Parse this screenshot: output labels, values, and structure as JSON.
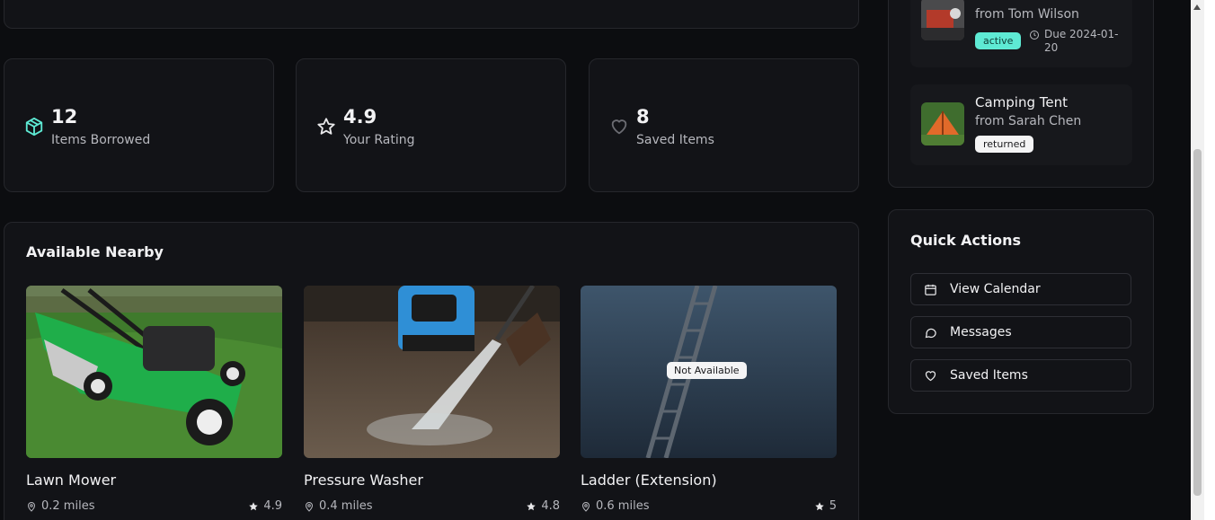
{
  "stats": [
    {
      "value": "12",
      "label": "Items Borrowed",
      "icon": "package-icon"
    },
    {
      "value": "4.9",
      "label": "Your Rating",
      "icon": "star-icon"
    },
    {
      "value": "8",
      "label": "Saved Items",
      "icon": "heart-icon"
    }
  ],
  "available": {
    "title": "Available Nearby",
    "items": [
      {
        "name": "Lawn Mower",
        "distance": "0.2 miles",
        "rating": "4.9",
        "available": true
      },
      {
        "name": "Pressure Washer",
        "distance": "0.4 miles",
        "rating": "4.8",
        "available": true
      },
      {
        "name": "Ladder (Extension)",
        "distance": "0.6 miles",
        "rating": "5",
        "available": false,
        "badge": "Not Available"
      }
    ]
  },
  "borrowed": {
    "items": [
      {
        "from": "from Tom Wilson",
        "status": "active",
        "due": "Due 2024-01-20"
      },
      {
        "title": "Camping Tent",
        "from": "from Sarah Chen",
        "status": "returned"
      }
    ]
  },
  "quick_actions": {
    "title": "Quick Actions",
    "buttons": [
      {
        "label": "View Calendar",
        "icon": "calendar-icon"
      },
      {
        "label": "Messages",
        "icon": "message-icon"
      },
      {
        "label": "Saved Items",
        "icon": "heart-icon"
      }
    ]
  },
  "colors": {
    "background": "#0c0d10",
    "card": "#121317",
    "accent": "#5eead4"
  }
}
